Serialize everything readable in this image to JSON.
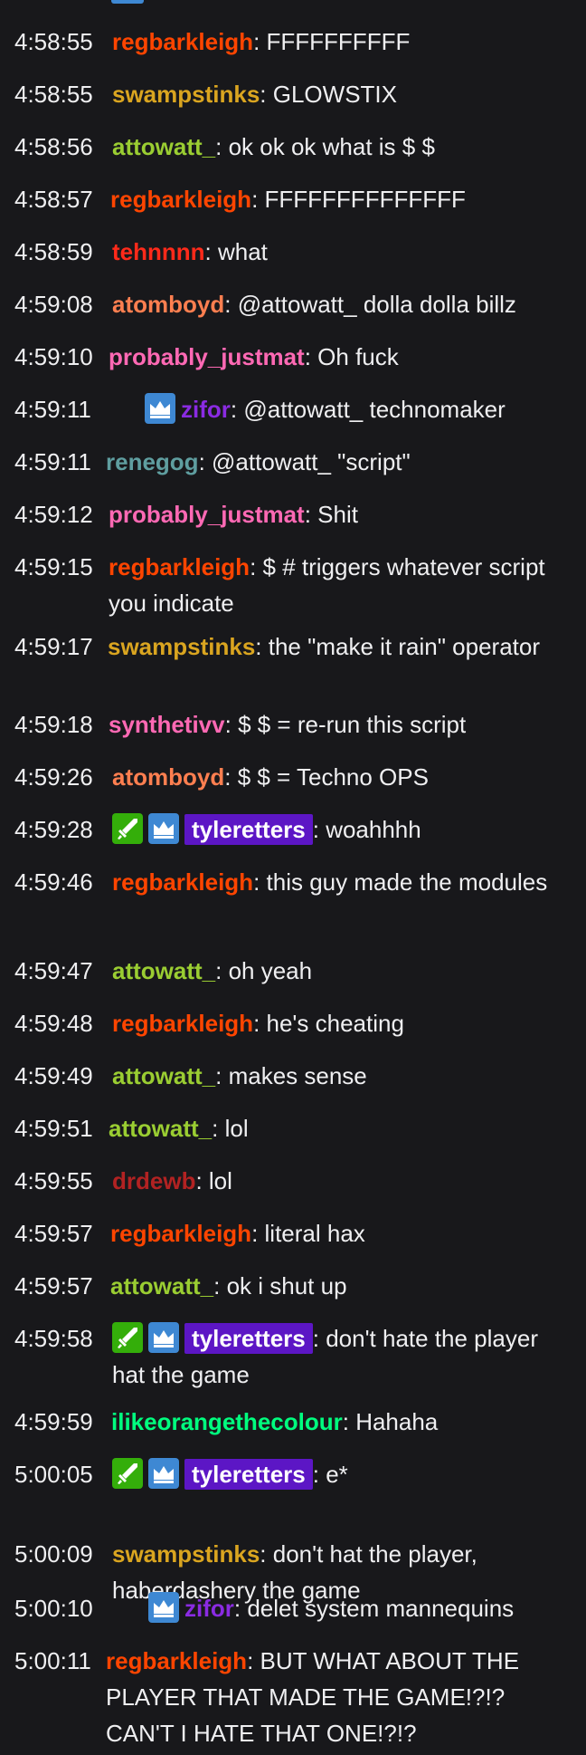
{
  "colors": {
    "background": "#18181b",
    "text": "#efeff1",
    "prime_badge": "#3e88d3",
    "mod_badge": "#34ae0a",
    "highlight": "#5c16c5"
  },
  "messages": [
    {
      "time": "4:58:55",
      "user": "regbarkleigh",
      "color": "#ff4500",
      "text": "FFFFFFFFFF",
      "badges": [],
      "highlight": false
    },
    {
      "time": "4:58:55",
      "user": "swampstinks",
      "color": "#daa520",
      "text": "GLOWSTIX",
      "badges": [],
      "highlight": false
    },
    {
      "time": "4:58:56",
      "user": "attowatt_",
      "color": "#9acd32",
      "text": "ok ok ok what is $ $",
      "badges": [],
      "highlight": false
    },
    {
      "time": "4:58:57",
      "user": "regbarkleigh",
      "color": "#ff4500",
      "text": "FFFFFFFFFFFFFF",
      "badges": [],
      "highlight": false
    },
    {
      "time": "4:58:59",
      "user": "tehnnnn",
      "color": "#ff2a1a",
      "text": "what",
      "badges": [],
      "highlight": false
    },
    {
      "time": "4:59:08",
      "user": "atomboyd",
      "color": "#ff7f50",
      "text": "@attowatt_ dolla dolla billz",
      "badges": [],
      "highlight": false
    },
    {
      "time": "4:59:10",
      "user": "probably_justmat",
      "color": "#ff69b4",
      "text": "Oh fuck",
      "badges": [],
      "highlight": false
    },
    {
      "time": "4:59:11",
      "user": "zifor",
      "color": "#8a2be2",
      "text": "@attowatt_ technomaker",
      "badges": [
        "crown-icon"
      ],
      "highlight": false
    },
    {
      "time": "4:59:11",
      "user": "renegog",
      "color": "#5f9ea0",
      "text": "@attowatt_ \"script\"",
      "badges": [],
      "highlight": false
    },
    {
      "time": "4:59:12",
      "user": "probably_justmat",
      "color": "#ff69b4",
      "text": "Shit",
      "badges": [],
      "highlight": false
    },
    {
      "time": "4:59:15",
      "user": "regbarkleigh",
      "color": "#ff4500",
      "text": "$ # triggers whatever script you indicate",
      "badges": [],
      "highlight": false
    },
    {
      "time": "4:59:17",
      "user": "swampstinks",
      "color": "#daa520",
      "text": "the \"make it rain\" operator",
      "badges": [],
      "highlight": false
    },
    {
      "time": "4:59:18",
      "user": "synthetivv",
      "color": "#ff69b4",
      "text": "$ $ = re-run this script",
      "badges": [],
      "highlight": false
    },
    {
      "time": "4:59:26",
      "user": "atomboyd",
      "color": "#ff7f50",
      "text": "$ $ = Techno OPS",
      "badges": [],
      "highlight": false
    },
    {
      "time": "4:59:28",
      "user": "tyleretters",
      "color": "#ffffff",
      "text": "woahhhh",
      "badges": [
        "sword-icon",
        "crown-icon"
      ],
      "highlight": true
    },
    {
      "time": "4:59:46",
      "user": "regbarkleigh",
      "color": "#ff4500",
      "text": "this guy made the modules",
      "badges": [],
      "highlight": false
    },
    {
      "time": "4:59:47",
      "user": "attowatt_",
      "color": "#9acd32",
      "text": "oh yeah",
      "badges": [],
      "highlight": false
    },
    {
      "time": "4:59:48",
      "user": "regbarkleigh",
      "color": "#ff4500",
      "text": "he's cheating",
      "badges": [],
      "highlight": false
    },
    {
      "time": "4:59:49",
      "user": "attowatt_",
      "color": "#9acd32",
      "text": "makes sense",
      "badges": [],
      "highlight": false
    },
    {
      "time": "4:59:51",
      "user": "attowatt_",
      "color": "#9acd32",
      "text": "lol",
      "badges": [],
      "highlight": false
    },
    {
      "time": "4:59:55",
      "user": "drdewb",
      "color": "#b22222",
      "text": "lol",
      "badges": [],
      "highlight": false
    },
    {
      "time": "4:59:57",
      "user": "regbarkleigh",
      "color": "#ff4500",
      "text": "literal hax",
      "badges": [],
      "highlight": false
    },
    {
      "time": "4:59:57",
      "user": "attowatt_",
      "color": "#9acd32",
      "text": "ok i shut up",
      "badges": [],
      "highlight": false
    },
    {
      "time": "4:59:58",
      "user": "tyleretters",
      "color": "#ffffff",
      "text": "don't hate the player hat the game",
      "badges": [
        "sword-icon",
        "crown-icon"
      ],
      "highlight": true
    },
    {
      "time": "4:59:59",
      "user": "ilikeorangethecolour",
      "color": "#00ff7f",
      "text": "Hahaha",
      "badges": [],
      "highlight": false
    },
    {
      "time": "5:00:05",
      "user": "tyleretters",
      "color": "#ffffff",
      "text": "e*",
      "badges": [
        "sword-icon",
        "crown-icon"
      ],
      "highlight": true
    },
    {
      "time": "5:00:09",
      "user": "swampstinks",
      "color": "#daa520",
      "text": "don't hat the player, haberdashery the game",
      "badges": [],
      "highlight": false
    },
    {
      "time": "5:00:10",
      "user": "zifor",
      "color": "#8a2be2",
      "text": "delet system mannequins",
      "badges": [
        "crown-icon"
      ],
      "highlight": false
    },
    {
      "time": "5:00:11",
      "user": "regbarkleigh",
      "color": "#ff4500",
      "text": "BUT WHAT ABOUT THE PLAYER THAT MADE THE GAME!?!? CAN'T I HATE THAT ONE!?!?",
      "badges": [],
      "highlight": false
    }
  ]
}
